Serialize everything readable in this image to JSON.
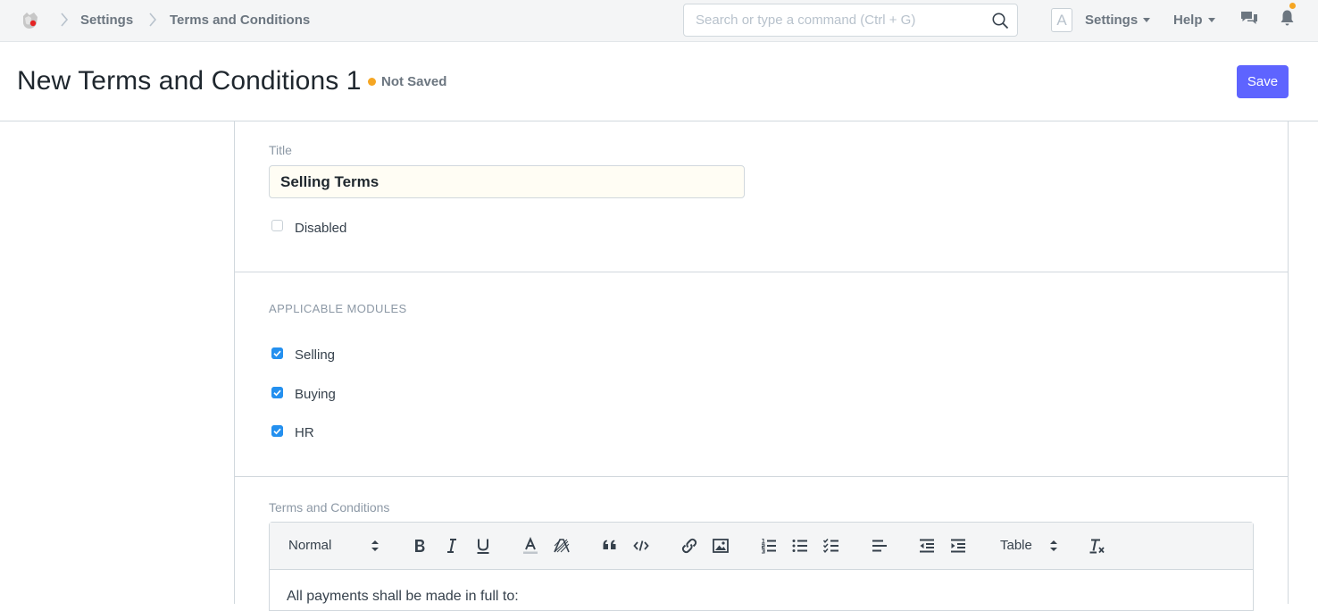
{
  "navbar": {
    "breadcrumbs": [
      "Settings",
      "Terms and Conditions"
    ],
    "search_placeholder": "Search or type a command (Ctrl + G)",
    "avatar_letter": "A",
    "settings_menu": "Settings",
    "help_menu": "Help"
  },
  "header": {
    "title": "New Terms and Conditions 1",
    "status": "Not Saved",
    "save_label": "Save"
  },
  "form": {
    "title_label": "Title",
    "title_value": "Selling Terms",
    "disabled_label": "Disabled",
    "disabled_checked": false,
    "modules_section": "APPLICABLE MODULES",
    "modules": [
      {
        "label": "Selling",
        "checked": true
      },
      {
        "label": "Buying",
        "checked": true
      },
      {
        "label": "HR",
        "checked": true
      }
    ],
    "terms_label": "Terms and Conditions",
    "editor": {
      "format_select": "Normal",
      "table_select": "Table",
      "content": "All payments shall be made in full to:"
    }
  },
  "colors": {
    "primary": "#5e64ff",
    "checkbox": "#2490ef",
    "indicator": "#f5a623"
  }
}
